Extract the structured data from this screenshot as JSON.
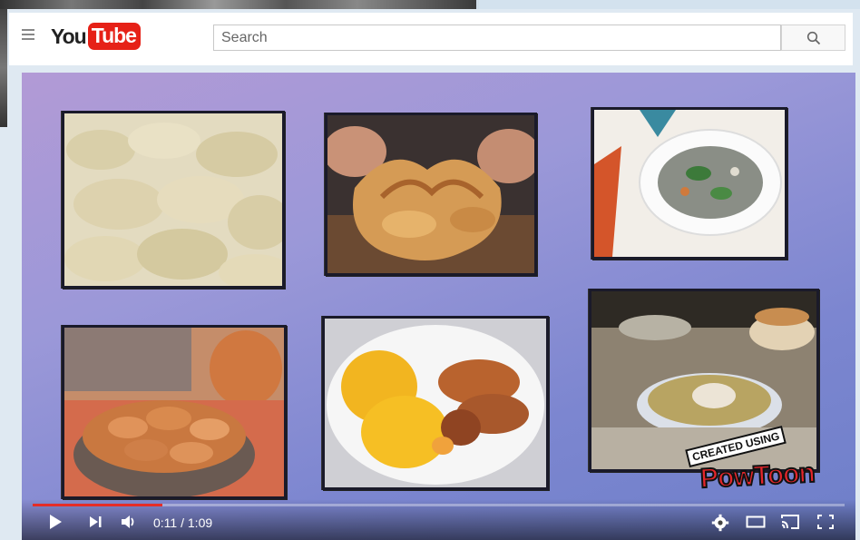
{
  "masthead": {
    "logo_you": "You",
    "logo_tube": "Tube",
    "search_placeholder": "Search"
  },
  "video": {
    "overlay_created": "CREATED USING",
    "overlay_brand": "PowToon",
    "current_time": "0:11",
    "separator": " / ",
    "duration": "1:09",
    "progress_fraction": 0.16
  },
  "colors": {
    "youtube_red": "#e62117",
    "progress_red": "#e52d27"
  },
  "icons": [
    "hamburger-menu-icon",
    "search-icon",
    "play-icon",
    "next-icon",
    "volume-icon",
    "settings-gear-icon",
    "theater-mode-icon",
    "cast-icon",
    "fullscreen-icon"
  ]
}
